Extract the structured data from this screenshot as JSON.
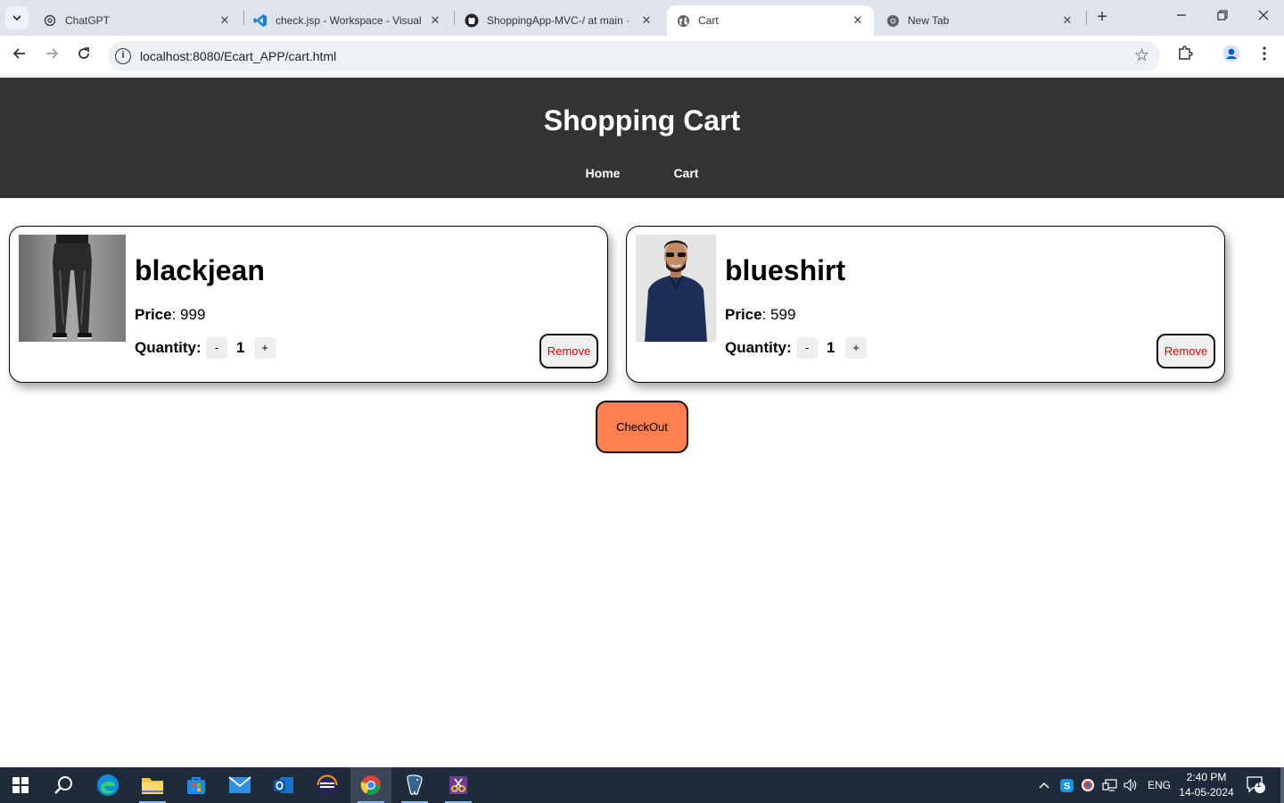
{
  "browser": {
    "tabs": [
      {
        "title": "ChatGPT",
        "icon": "chatgpt-icon",
        "active": false
      },
      {
        "title": "check.jsp - Workspace - Visual",
        "icon": "vscode-icon",
        "active": false
      },
      {
        "title": "ShoppingApp-MVC-/ at main ·",
        "icon": "github-icon",
        "active": false
      },
      {
        "title": "Cart",
        "icon": "globe-icon",
        "active": true
      },
      {
        "title": "New Tab",
        "icon": "chrome-icon",
        "active": false
      }
    ],
    "url": "localhost:8080/Ecart_APP/cart.html"
  },
  "page": {
    "title": "Shopping Cart",
    "nav": {
      "home": "Home",
      "cart": "Cart"
    },
    "items": [
      {
        "name": "blackjean",
        "price_label": "Price",
        "price": "999",
        "quantity_label": "Quantity:",
        "quantity": "1",
        "minus": "-",
        "plus": "+",
        "remove_label": "Remove"
      },
      {
        "name": "blueshirt",
        "price_label": "Price",
        "price": "599",
        "quantity_label": "Quantity:",
        "quantity": "1",
        "minus": "-",
        "plus": "+",
        "remove_label": "Remove"
      }
    ],
    "checkout_label": "CheckOut"
  },
  "taskbar": {
    "language": "ENG",
    "time": "2:40 PM",
    "date": "14-05-2024",
    "notification_count": "1"
  },
  "colors": {
    "header_bg": "#333333",
    "checkout_bg": "#ff7f50",
    "remove_text": "#dd0000"
  }
}
